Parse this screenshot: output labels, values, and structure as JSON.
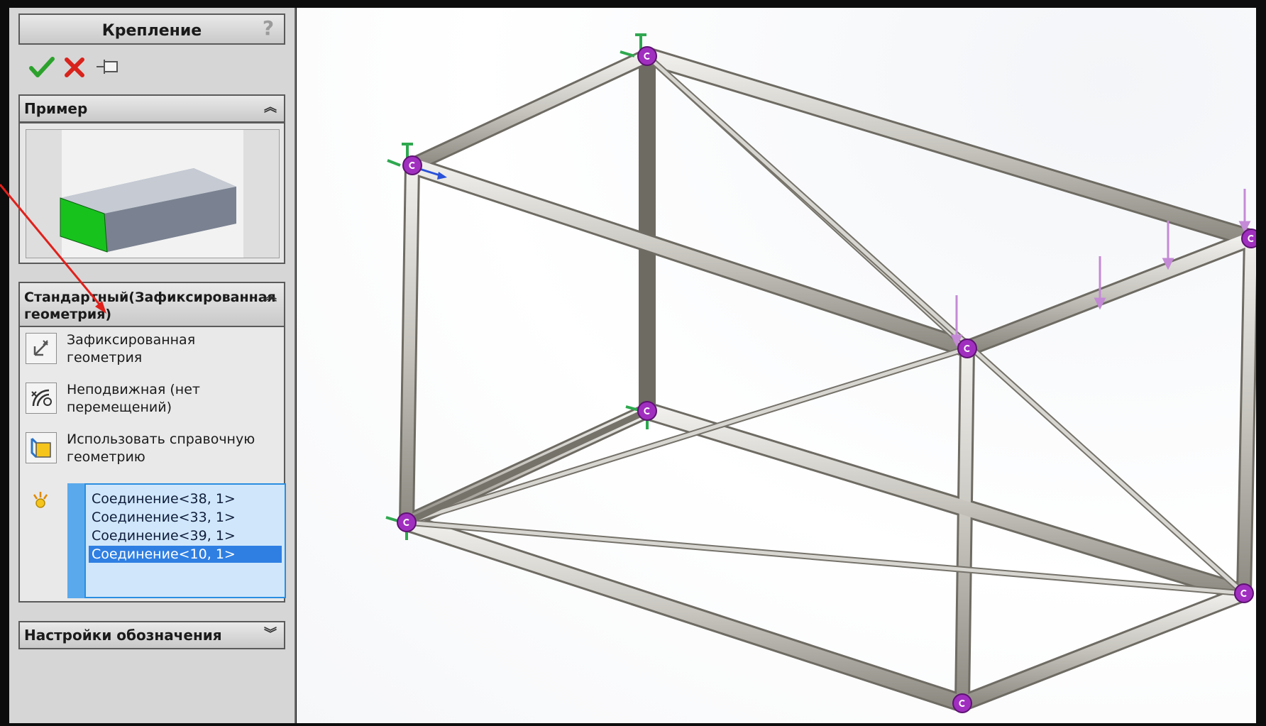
{
  "title": "Крепление",
  "help_label": "?",
  "toolbar": {
    "ok_icon": "check-icon",
    "cancel_icon": "cross-icon",
    "pin_icon": "pushpin-icon"
  },
  "example_section": {
    "title": "Пример"
  },
  "standard_section": {
    "title_line1": "Стандартный(Зафиксированная",
    "title_line2": "геометрия)",
    "options": [
      {
        "icon": "fixed-geometry-icon",
        "line1": "Зафиксированная",
        "line2": "геометрия"
      },
      {
        "icon": "immovable-icon",
        "line1": "Неподвижная (нет",
        "line2": "перемещений)"
      },
      {
        "icon": "reference-geometry-icon",
        "line1": "Использовать справочную",
        "line2": "геометрию"
      }
    ],
    "selection_icon": "vertex-selection-icon",
    "selections": [
      "Соединение<38, 1>",
      "Соединение<33, 1>",
      "Соединение<39, 1>",
      "Соединение<10, 1>"
    ],
    "selected_index": 3
  },
  "notation_section": {
    "title": "Настройки обозначения"
  },
  "colors": {
    "selection_highlight": "#2f7fe3",
    "joint_marker": "#a02fbf",
    "fixture_arrow": "#2fa84f",
    "load_arrow": "#c48ad6",
    "annotation_arrow": "#e0201b"
  }
}
